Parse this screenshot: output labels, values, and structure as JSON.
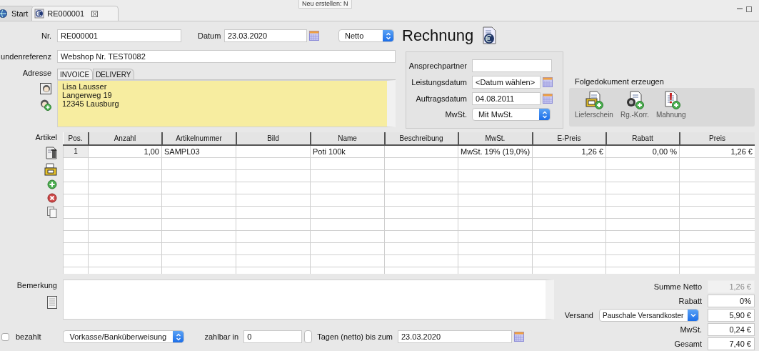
{
  "tabs": [
    {
      "label": "Start",
      "selected": false,
      "closable": false
    },
    {
      "label": "RE000001",
      "selected": true,
      "closable": true
    }
  ],
  "tooltip": {
    "text": "Neu erstellen: N"
  },
  "header": {
    "nr_label": "Nr.",
    "nr_value": "RE000001",
    "date_label": "Datum",
    "date_value": "23.03.2020",
    "price_mode": "Netto",
    "title": "Rechnung"
  },
  "reference": {
    "label": "undenreferenz",
    "value": "Webshop Nr. TEST0082"
  },
  "address": {
    "label": "Adresse",
    "tabs": [
      {
        "label": "INVOICE",
        "selected": true
      },
      {
        "label": "DELIVERY",
        "selected": false
      }
    ],
    "lines": [
      "Lisa Lausser",
      "Langerweg 19",
      "12345 Lausburg"
    ]
  },
  "details": {
    "contact_label": "Ansprechpartner",
    "service_date_label": "Leistungsdatum",
    "service_date_value": "<Datum wählen>",
    "order_date_label": "Auftragsdatum",
    "order_date_value": "04.08.2011",
    "vat_label": "MwSt.",
    "vat_value": "Mit MwSt."
  },
  "follow_up": {
    "title": "Folgedokument erzeugen",
    "buttons": [
      {
        "label": "Lieferschein",
        "kind": "delivery"
      },
      {
        "label": "Rg.-Korr.",
        "kind": "correction"
      },
      {
        "label": "Mahnung",
        "kind": "reminder"
      }
    ]
  },
  "items": {
    "label": "Artikel",
    "columns": [
      "Pos.",
      "Anzahl",
      "Artikelnummer",
      "Bild",
      "Name",
      "Beschreibung",
      "MwSt.",
      "E-Preis",
      "Rabatt",
      "Preis"
    ],
    "rows": [
      {
        "cells": [
          "1",
          "1,00",
          "SAMPL03",
          null,
          "Poti 100k",
          null,
          "MwSt. 19% (19,0%)",
          "1,26 €",
          "0,00 %",
          "1,26 €"
        ]
      }
    ]
  },
  "remark": {
    "label": "Bemerkung"
  },
  "payment": {
    "paid_label": "bezahlt",
    "paid": false,
    "method": "Vorkasse/Banküberweisung",
    "due_label": "zahlbar in",
    "due_days": "0",
    "days_label": "Tagen (netto) bis zum",
    "due_date": "23.03.2020"
  },
  "totals": {
    "net_label": "Summe Netto",
    "net_value": "1,26 €",
    "net_disabled": true,
    "discount_label": "Rabatt",
    "discount_value": "0%",
    "shipping_label": "Versand",
    "shipping_method": "Pauschale Versandkoster",
    "shipping_value": "5,90 €",
    "vat_label": "MwSt.",
    "vat_value": "0,24 €",
    "total_label": "Gesamt",
    "total_value": "7,40 €"
  }
}
